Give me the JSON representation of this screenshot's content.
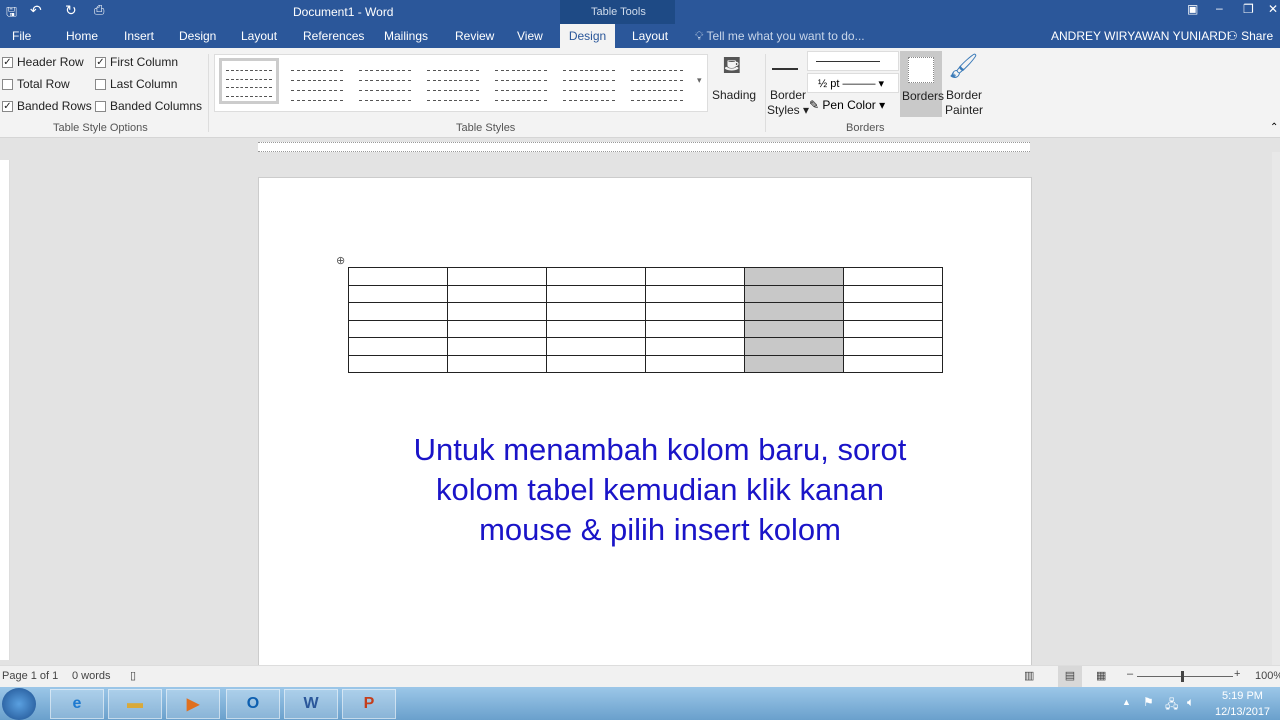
{
  "title": {
    "doc": "Document1 - Word",
    "context": "Table Tools"
  },
  "tabs": [
    "File",
    "Home",
    "Insert",
    "Design",
    "Layout",
    "References",
    "Mailings",
    "Review",
    "View",
    "Design",
    "Layout"
  ],
  "tell_me": "Tell me what you want to do...",
  "user": "ANDREY WIRYAWAN YUNIARDI",
  "share": "Share",
  "options": [
    {
      "label": "Header Row",
      "checked": true
    },
    {
      "label": "Total Row",
      "checked": false
    },
    {
      "label": "Banded Rows",
      "checked": true
    },
    {
      "label": "First Column",
      "checked": true
    },
    {
      "label": "Last Column",
      "checked": false
    },
    {
      "label": "Banded Columns",
      "checked": false
    }
  ],
  "groups": {
    "options": "Table Style Options",
    "styles": "Table Styles",
    "borders": "Borders"
  },
  "buttons": {
    "shading": "Shading",
    "border_styles_1": "Border",
    "border_styles_2": "Styles",
    "pen_weight": "½ pt",
    "pen_color": "Pen Color",
    "borders": "Borders",
    "painter_1": "Border",
    "painter_2": "Painter"
  },
  "message": "Untuk menambah kolom baru, sorot kolom tabel kemudian klik kanan mouse & pilih insert kolom",
  "status": {
    "page": "Page 1 of 1",
    "words": "0 words",
    "zoom": "100%"
  },
  "clock": {
    "time": "5:19 PM",
    "date": "12/13/2017"
  },
  "colors": {
    "brand": "#2b579a",
    "text": "#1a14c8",
    "selected": "#c8c8c8"
  }
}
